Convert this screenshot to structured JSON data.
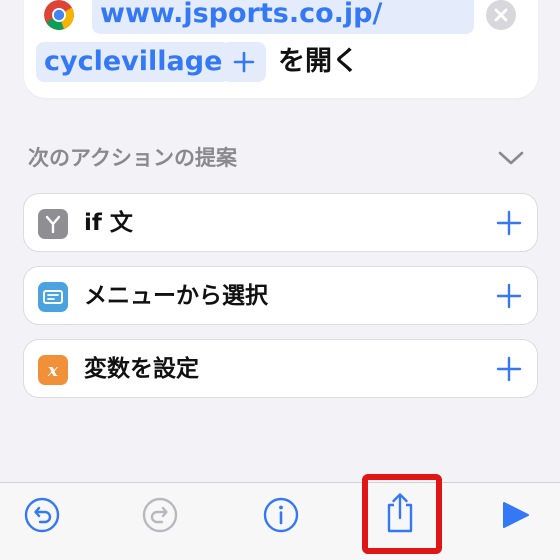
{
  "action_card": {
    "url_line1": "www.jsports.co.jp/",
    "url_line2": "cyclevillage",
    "open_label": "を開く",
    "app_icon": "chrome-icon",
    "clear_icon": "clear-icon"
  },
  "suggestions": {
    "header": "次のアクションの提案",
    "items": [
      {
        "label": "if 文",
        "icon": "branch-icon",
        "icon_color": "#8e8e93"
      },
      {
        "label": "メニューから選択",
        "icon": "menu-icon",
        "icon_color": "#4aa3df"
      },
      {
        "label": "変数を設定",
        "icon": "variable-icon",
        "icon_color": "#f0913a"
      }
    ]
  },
  "toolbar": {
    "buttons": [
      "undo-icon",
      "redo-icon",
      "info-icon",
      "share-icon",
      "play-icon"
    ]
  },
  "colors": {
    "accent": "#3478f6",
    "token_bg": "#e4ecfb",
    "highlight": "#e01515",
    "background": "#f2f2f7"
  }
}
